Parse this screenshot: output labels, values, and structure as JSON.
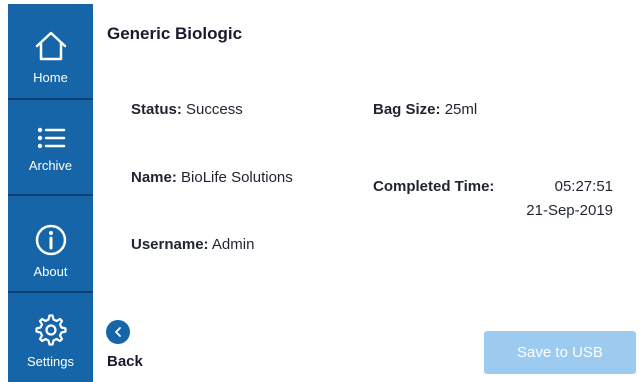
{
  "sidebar": {
    "items": [
      {
        "label": "Home",
        "icon": "home-icon"
      },
      {
        "label": "Archive",
        "icon": "list-icon"
      },
      {
        "label": "About",
        "icon": "info-icon"
      },
      {
        "label": "Settings",
        "icon": "gear-icon"
      }
    ],
    "colors": {
      "background": "#1565a8",
      "separator": "#0b4273"
    }
  },
  "page": {
    "title": "Generic Biologic"
  },
  "details": {
    "status": {
      "label": "Status:",
      "value": "Success"
    },
    "name": {
      "label": "Name:",
      "value": "BioLife Solutions"
    },
    "username": {
      "label": "Username:",
      "value": "Admin"
    },
    "bag_size": {
      "label": "Bag Size:",
      "value": "25ml"
    },
    "completed": {
      "label": "Completed Time:",
      "time": "05:27:51",
      "date": "21-Sep-2019"
    }
  },
  "footer": {
    "back_label": "Back",
    "save_label": "Save to USB",
    "save_enabled": false
  }
}
